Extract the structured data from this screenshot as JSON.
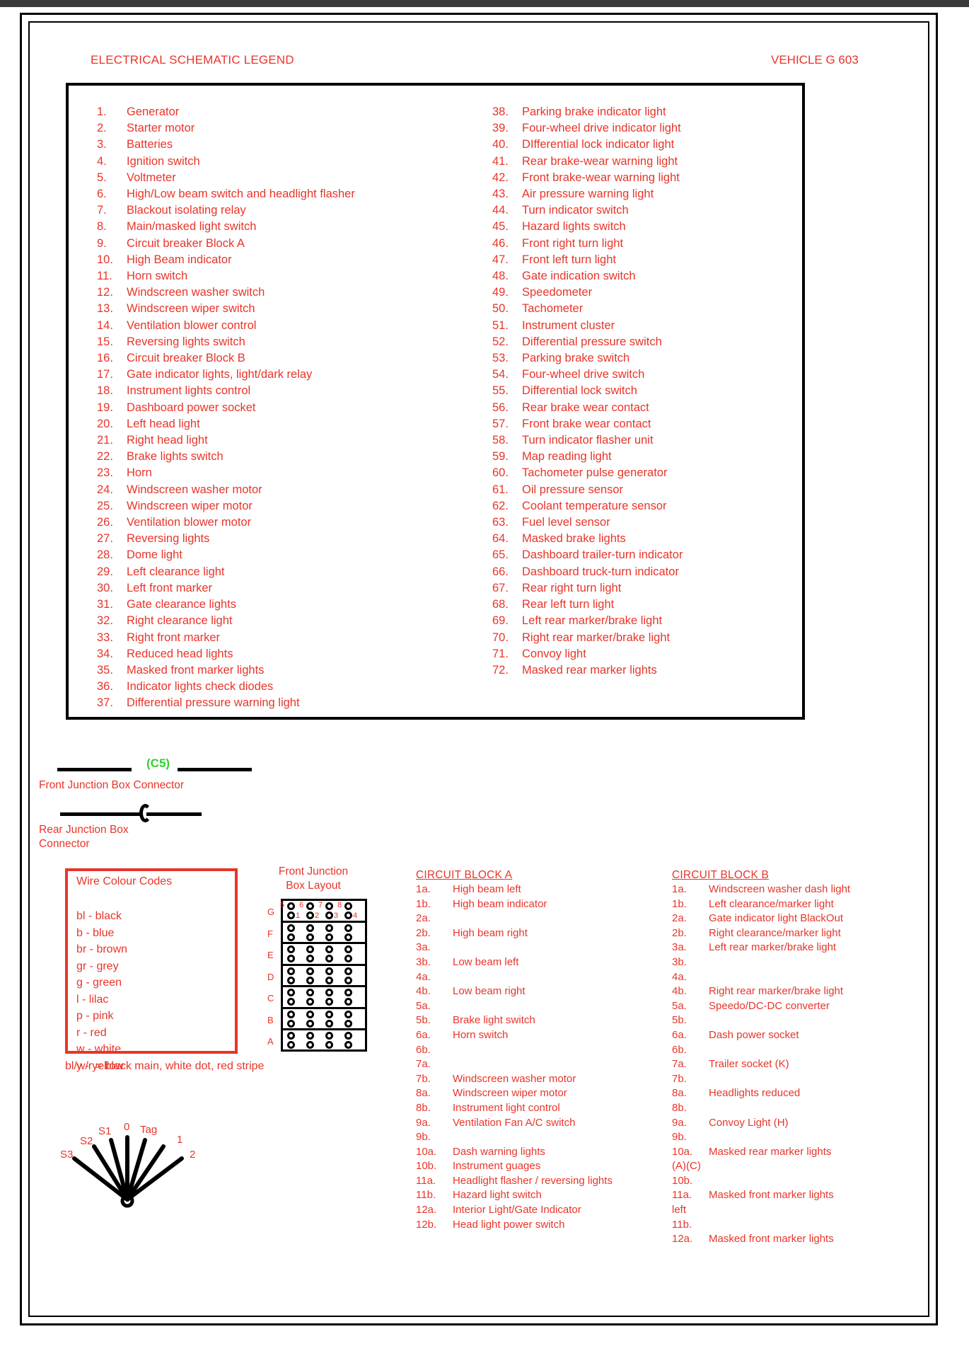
{
  "header": {
    "title_left": "ELECTRICAL SCHEMATIC LEGEND",
    "title_right": "VEHICLE G 603"
  },
  "legend": {
    "left_items": [
      {
        "num": "1.",
        "text": "Generator"
      },
      {
        "num": "2.",
        "text": "Starter motor"
      },
      {
        "num": "3.",
        "text": "Batteries"
      },
      {
        "num": "4.",
        "text": "Ignition switch"
      },
      {
        "num": "5.",
        "text": "Voltmeter"
      },
      {
        "num": "6.",
        "text": "High/Low beam switch and headlight flasher"
      },
      {
        "num": "7.",
        "text": "Blackout isolating relay"
      },
      {
        "num": "8.",
        "text": "Main/masked light switch"
      },
      {
        "num": "9.",
        "text": "Circuit breaker Block A"
      },
      {
        "num": "10.",
        "text": "High Beam indicator"
      },
      {
        "num": "11.",
        "text": "Horn switch"
      },
      {
        "num": "12.",
        "text": "Windscreen washer switch"
      },
      {
        "num": "13.",
        "text": "Windscreen wiper switch"
      },
      {
        "num": "14.",
        "text": "Ventilation blower control"
      },
      {
        "num": "15.",
        "text": "Reversing lights switch"
      },
      {
        "num": "16.",
        "text": "Circuit breaker Block B"
      },
      {
        "num": "17.",
        "text": "Gate indicator lights, light/dark relay"
      },
      {
        "num": "18.",
        "text": "Instrument lights control"
      },
      {
        "num": "19.",
        "text": "Dashboard power socket"
      },
      {
        "num": "20.",
        "text": "Left head light"
      },
      {
        "num": "21.",
        "text": "Right head light"
      },
      {
        "num": "22.",
        "text": "Brake lights switch"
      },
      {
        "num": "23.",
        "text": "Horn"
      },
      {
        "num": "24.",
        "text": "Windscreen washer motor"
      },
      {
        "num": "25.",
        "text": "Windscreen wiper motor"
      },
      {
        "num": "26.",
        "text": "Ventilation blower motor"
      },
      {
        "num": "27.",
        "text": "Reversing lights"
      },
      {
        "num": "28.",
        "text": "Dome light"
      },
      {
        "num": "29.",
        "text": "Left clearance light"
      },
      {
        "num": "30.",
        "text": "Left front marker"
      },
      {
        "num": "31.",
        "text": "Gate clearance lights"
      },
      {
        "num": "32.",
        "text": "Right clearance light"
      },
      {
        "num": "33.",
        "text": "Right front marker"
      },
      {
        "num": "34.",
        "text": "Reduced head lights"
      },
      {
        "num": "35.",
        "text": "Masked front marker lights"
      },
      {
        "num": "36.",
        "text": "Indicator lights check diodes"
      },
      {
        "num": "37.",
        "text": "Differential pressure warning light"
      }
    ],
    "right_items": [
      {
        "num": "38.",
        "text": "Parking brake indicator light"
      },
      {
        "num": "39.",
        "text": "Four-wheel drive indicator light"
      },
      {
        "num": "40.",
        "text": "DIfferential lock indicator light"
      },
      {
        "num": "41.",
        "text": "Rear brake-wear warning light"
      },
      {
        "num": "42.",
        "text": "Front brake-wear warning light"
      },
      {
        "num": "43.",
        "text": "Air pressure warning light"
      },
      {
        "num": "44.",
        "text": "Turn indicator switch"
      },
      {
        "num": "45.",
        "text": "Hazard lights switch"
      },
      {
        "num": "46.",
        "text": "Front right turn light"
      },
      {
        "num": "47.",
        "text": "Front left turn light"
      },
      {
        "num": "48.",
        "text": "Gate indication switch"
      },
      {
        "num": "49.",
        "text": "Speedometer"
      },
      {
        "num": "50.",
        "text": "Tachometer"
      },
      {
        "num": "51.",
        "text": "Instrument cluster"
      },
      {
        "num": "52.",
        "text": "Differential pressure switch"
      },
      {
        "num": "53.",
        "text": "Parking brake switch"
      },
      {
        "num": "54.",
        "text": "Four-wheel drive switch"
      },
      {
        "num": "55.",
        "text": "Differential lock switch"
      },
      {
        "num": "56.",
        "text": "Rear brake wear contact"
      },
      {
        "num": "57.",
        "text": "Front brake wear contact"
      },
      {
        "num": "58.",
        "text": "Turn indicator flasher unit"
      },
      {
        "num": "59.",
        "text": "Map reading light"
      },
      {
        "num": "60.",
        "text": "Tachometer pulse generator"
      },
      {
        "num": "61.",
        "text": "Oil pressure sensor"
      },
      {
        "num": "62.",
        "text": "Coolant temperature sensor"
      },
      {
        "num": "63.",
        "text": "Fuel level sensor"
      },
      {
        "num": "64.",
        "text": "Masked brake lights"
      },
      {
        "num": "65.",
        "text": "Dashboard trailer-turn indicator"
      },
      {
        "num": "66.",
        "text": "Dashboard truck-turn indicator"
      },
      {
        "num": "67.",
        "text": "Rear right turn light"
      },
      {
        "num": "68.",
        "text": "Rear left turn light"
      },
      {
        "num": "69.",
        "text": "Left rear marker/brake light"
      },
      {
        "num": "70.",
        "text": "Right rear marker/brake light"
      },
      {
        "num": "71.",
        "text": "Convoy light"
      },
      {
        "num": "72.",
        "text": "Masked rear marker lights"
      }
    ]
  },
  "connectors": {
    "front_label": "(C5)",
    "front_caption": "Front Junction Box Connector",
    "rear_caption": "Rear Junction Box Connector",
    "front_label_color": "#2fd22f"
  },
  "wire_codes": {
    "title": "Wire Colour Codes",
    "codes": [
      "bl - black",
      "b - blue",
      "br - brown",
      "gr - grey",
      "g - green",
      "l - lilac",
      "p - pink",
      "r - red",
      "w - white",
      "y - yellow"
    ],
    "note": "bl/w/r = black main, white dot, red stripe"
  },
  "switch_fan": {
    "labels": [
      "S3",
      "S2",
      "S1",
      "0",
      "Tag",
      "1",
      "2"
    ]
  },
  "junction_box": {
    "title_line1": "Front Junction",
    "title_line2": "Box Layout",
    "row_labels": [
      "G",
      "F",
      "E",
      "D",
      "C",
      "B",
      "A"
    ],
    "top_numbers": [
      "5",
      "6",
      "7",
      "8"
    ],
    "bottom_numbers": [
      "1",
      "2",
      "3",
      "4"
    ]
  },
  "circuit_block_a": {
    "heading": "CIRCUIT BLOCK A",
    "rows": [
      {
        "num": "1a.",
        "text": "High beam left"
      },
      {
        "num": "1b.",
        "text": "High beam indicator"
      },
      {
        "num": "2a.",
        "text": ""
      },
      {
        "num": "2b.",
        "text": "High beam right"
      },
      {
        "num": "3a.",
        "text": ""
      },
      {
        "num": "3b.",
        "text": "Low beam left"
      },
      {
        "num": "4a.",
        "text": ""
      },
      {
        "num": "4b.",
        "text": "Low beam right"
      },
      {
        "num": "5a.",
        "text": ""
      },
      {
        "num": "5b.",
        "text": "Brake light switch"
      },
      {
        "num": "6a.",
        "text": "Horn switch"
      },
      {
        "num": "6b.",
        "text": ""
      },
      {
        "num": "7a.",
        "text": ""
      },
      {
        "num": "7b.",
        "text": "Windscreen washer motor"
      },
      {
        "num": "8a.",
        "text": "Windscreen wiper motor"
      },
      {
        "num": "8b.",
        "text": "Instrument light control"
      },
      {
        "num": "9a.",
        "text": "Ventilation Fan A/C switch"
      },
      {
        "num": "9b.",
        "text": ""
      },
      {
        "num": "10a.",
        "text": "Dash warning lights"
      },
      {
        "num": "10b.",
        "text": "Instrument guages"
      },
      {
        "num": "11a.",
        "text": "Headlight flasher / reversing lights"
      },
      {
        "num": "11b.",
        "text": "Hazard light switch"
      },
      {
        "num": "12a.",
        "text": "Interior Light/Gate Indicator"
      },
      {
        "num": "12b.",
        "text": "Head light power switch"
      }
    ]
  },
  "circuit_block_b": {
    "heading": "CIRCUIT BLOCK B",
    "rows": [
      {
        "num": "1a.",
        "text": "Windscreen washer dash light"
      },
      {
        "num": "1b.",
        "text": "Left clearance/marker light"
      },
      {
        "num": "2a.",
        "text": "Gate indicator light BlackOut"
      },
      {
        "num": "2b.",
        "text": "Right clearance/marker light"
      },
      {
        "num": "3a.",
        "text": "Left rear marker/brake light"
      },
      {
        "num": "3b.",
        "text": ""
      },
      {
        "num": "4a.",
        "text": ""
      },
      {
        "num": "4b.",
        "text": "Right rear marker/brake light"
      },
      {
        "num": "5a.",
        "text": "Speedo/DC-DC converter"
      },
      {
        "num": "5b.",
        "text": ""
      },
      {
        "num": "6a.",
        "text": "Dash power socket"
      },
      {
        "num": "6b.",
        "text": ""
      },
      {
        "num": "7a.",
        "text": "Trailer socket (K)"
      },
      {
        "num": "7b.",
        "text": ""
      },
      {
        "num": "8a.",
        "text": "Headlights reduced"
      },
      {
        "num": "8b.",
        "text": ""
      },
      {
        "num": "9a.",
        "text": "Convoy Light (H)"
      },
      {
        "num": "9b.",
        "text": ""
      },
      {
        "num": "10a.",
        "text": "Masked rear marker lights"
      },
      {
        "num": "(A)(C)",
        "text": ""
      },
      {
        "num": "10b.",
        "text": ""
      },
      {
        "num": "11a.",
        "text": "Masked front marker lights"
      },
      {
        "num": "left",
        "text": ""
      },
      {
        "num": "11b.",
        "text": ""
      },
      {
        "num": "12a.",
        "text": "Masked front marker lights"
      }
    ]
  }
}
